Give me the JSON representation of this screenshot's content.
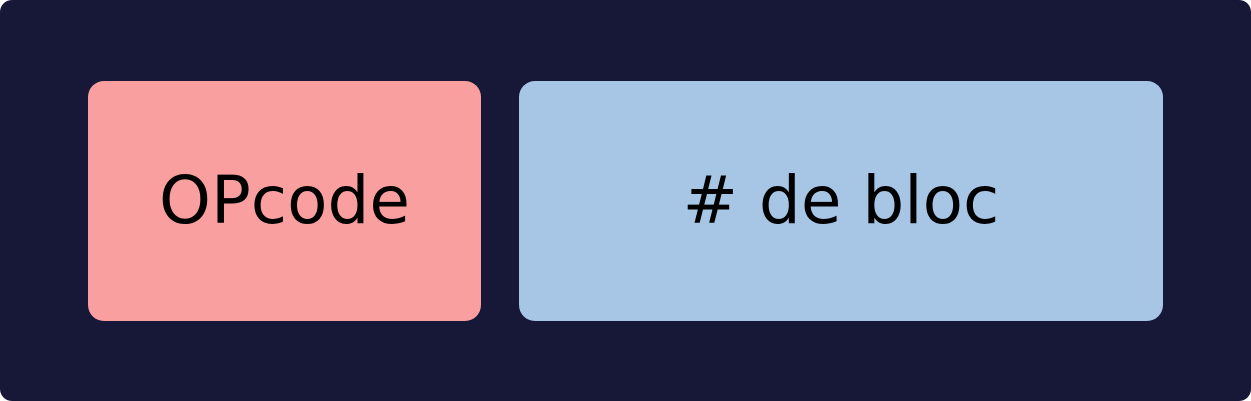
{
  "diagram": {
    "background_color": "#171737",
    "fields": [
      {
        "label": "OPcode",
        "color": "#fa9f9f"
      },
      {
        "label": "# de bloc",
        "color": "#a7c6e6"
      }
    ]
  }
}
